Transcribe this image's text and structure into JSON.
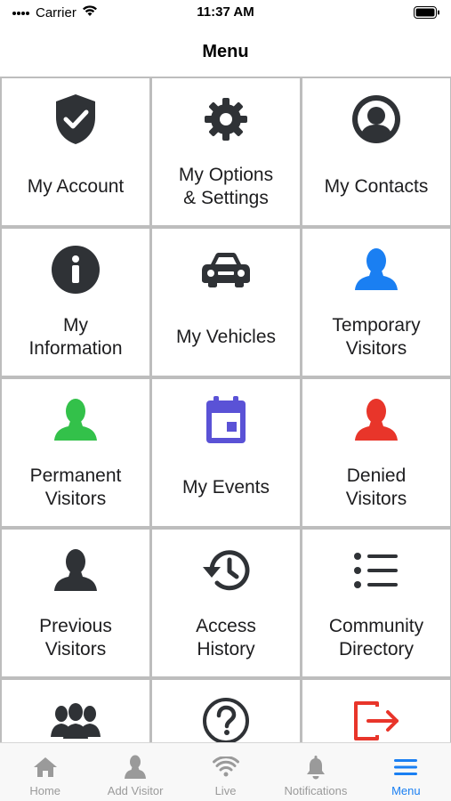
{
  "status_bar": {
    "carrier": "Carrier",
    "time": "11:37 AM"
  },
  "header": {
    "title": "Menu"
  },
  "menu_items": [
    {
      "label": "My Account",
      "icon": "shield-check-icon"
    },
    {
      "label": "My Options\n& Settings",
      "icon": "gear-icon"
    },
    {
      "label": "My Contacts",
      "icon": "person-circle-icon"
    },
    {
      "label": "My\nInformation",
      "icon": "info-icon"
    },
    {
      "label": "My Vehicles",
      "icon": "car-icon"
    },
    {
      "label": "Temporary\nVisitors",
      "icon": "person-blue-icon",
      "color": "#1a7ff2"
    },
    {
      "label": "Permanent\nVisitors",
      "icon": "person-green-icon",
      "color": "#33c14a"
    },
    {
      "label": "My Events",
      "icon": "calendar-icon",
      "color": "#5a52d6"
    },
    {
      "label": "Denied\nVisitors",
      "icon": "person-red-icon",
      "color": "#e8352a"
    },
    {
      "label": "Previous\nVisitors",
      "icon": "person-dark-icon"
    },
    {
      "label": "Access\nHistory",
      "icon": "history-icon"
    },
    {
      "label": "Community\nDirectory",
      "icon": "list-icon"
    },
    {
      "label": "",
      "icon": "group-icon"
    },
    {
      "label": "",
      "icon": "help-icon"
    },
    {
      "label": "",
      "icon": "logout-icon",
      "color": "#e8352a"
    }
  ],
  "tab_bar": {
    "tabs": [
      {
        "label": "Home",
        "icon": "home-icon"
      },
      {
        "label": "Add Visitor",
        "icon": "add-visitor-icon"
      },
      {
        "label": "Live",
        "icon": "wifi-icon"
      },
      {
        "label": "Notifications",
        "icon": "bell-icon"
      },
      {
        "label": "Menu",
        "icon": "menu-icon",
        "active": true
      }
    ]
  },
  "colors": {
    "icon_dark": "#2f3236",
    "accent_blue": "#1a7ff2",
    "green": "#33c14a",
    "red": "#e8352a",
    "purple": "#5a52d6",
    "tab_inactive": "#9a9a9a",
    "grid_border": "#bdbdbd"
  }
}
